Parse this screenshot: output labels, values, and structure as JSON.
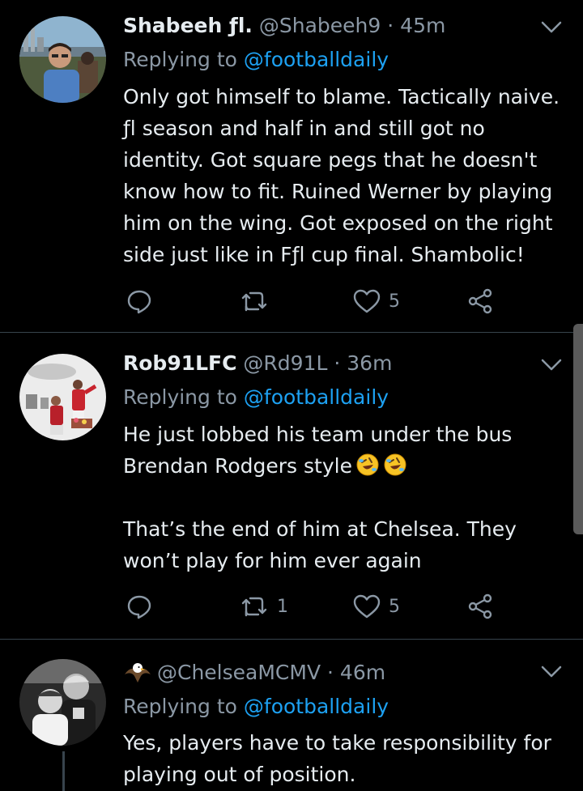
{
  "tweets": [
    {
      "name": "Shabeeh ƒl.",
      "handle": "@Shabeeh9",
      "time": "· 45m",
      "replying_prefix": "Replying to",
      "replying_to": "@footballdaily",
      "body": [
        "Only got himself to blame. Tactically naive. ƒl season and half in and still got no identity. Got square pegs that he doesn't know how to fit. Ruined Werner by playing him on the wing. Got exposed on the right side just like in Fƒl cup final. Shambolic!"
      ],
      "retweets": "",
      "likes": "5"
    },
    {
      "name": "Rob91LFC",
      "handle": "@Rd91L",
      "time": "· 36m",
      "replying_prefix": "Replying to",
      "replying_to": "@footballdaily",
      "body_line1": "He just lobbed his team under the bus Brendan Rodgers style",
      "body_line2": "That’s the end of him at Chelsea. They won’t play for him ever again",
      "retweets": "1",
      "likes": "5"
    },
    {
      "name": "",
      "handle": "@ChelseaMCMV",
      "time": "· 46m",
      "replying_prefix": "Replying to",
      "replying_to": "@footballdaily",
      "body": [
        "Yes, players have to take responsibility for playing out of position."
      ]
    }
  ],
  "icons": {
    "reply": "reply-icon",
    "retweet": "retweet-icon",
    "like": "heart-icon",
    "share": "share-icon",
    "more": "chevron-down-icon",
    "emoji": "rolling-laughing-emoji",
    "badge": "eagle-emoji"
  },
  "colors": {
    "background": "#000000",
    "text": "#e6ecf0",
    "muted": "#8b98a5",
    "link": "#1da1f2",
    "divider": "#38444d"
  }
}
